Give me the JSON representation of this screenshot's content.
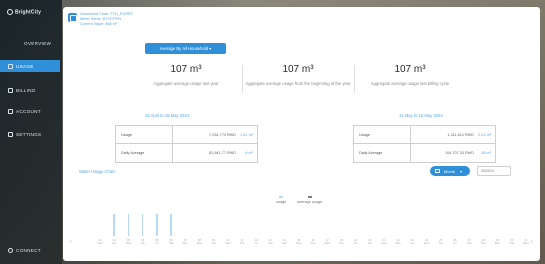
{
  "sidebar": {
    "logo": "BrightCity",
    "items": [
      {
        "id": "overview",
        "label": "OVERVIEW"
      },
      {
        "id": "usage",
        "label": "USAGE"
      },
      {
        "id": "billing",
        "label": "BILLING"
      },
      {
        "id": "account",
        "label": "ACCOUNT"
      },
      {
        "id": "settings",
        "label": "SETTINGS"
      }
    ],
    "connect": "CONNECT"
  },
  "household": {
    "line1": "Household Code: FTH_PORRT",
    "line2": "Meter Serial: BTCFFPIN",
    "line3": "Current Value: 888 m³"
  },
  "avg_button": "Average By All Household ▾",
  "stats": [
    {
      "value": "107 m³",
      "label": "Aggregate average usage last year"
    },
    {
      "value": "107 m³",
      "label": "Aggregate average usage from the beginning of the year"
    },
    {
      "value": "107 m³",
      "label": "Aggregate average usage last billing cycle"
    }
  ],
  "ranges": {
    "left": "15 April to 15 May 2024",
    "right": "15 May to 15 May 2024"
  },
  "table_left": {
    "rows": [
      {
        "key": "Usage",
        "value": "7,034,770 RWD",
        "unit": "1.61 m³"
      },
      {
        "key": "Daily Average",
        "value": "62,641.77 RWD",
        "unit": "4 m³"
      }
    ]
  },
  "table_right": {
    "rows": [
      {
        "key": "Usage",
        "value": "1,311,612 RWD",
        "unit": "2.01 m³"
      },
      {
        "key": "Daily Average",
        "value": "104,707.33 RWD",
        "unit": "28 m³"
      }
    ]
  },
  "chart_section": {
    "title": "Water Usage Chart",
    "period_button": "Month",
    "date_value": "05/2024"
  },
  "chart_data": {
    "type": "bar",
    "series": [
      {
        "name": "usage",
        "color": "#b6d9f6"
      },
      {
        "name": "average usage",
        "color": "#7a7a7a"
      }
    ],
    "x_labels": [
      "01",
      "02",
      "03",
      "04",
      "05",
      "06",
      "07",
      "08",
      "09",
      "10",
      "11",
      "12",
      "13",
      "14",
      "15",
      "16",
      "17",
      "18",
      "19",
      "20",
      "21",
      "22",
      "23",
      "24",
      "25",
      "26",
      "27",
      "28",
      "29",
      "30",
      "31"
    ],
    "x_labels_sub": [
      "Mon",
      "Tue",
      "Wed",
      "Thu",
      "Fri",
      "Sat",
      "Sun",
      "Mon",
      "Tue",
      "Wed",
      "Thu",
      "Fri",
      "Sat",
      "Sun",
      "Mon",
      "Tue",
      "Wed",
      "Thu",
      "Fri",
      "Sat",
      "Sun",
      "Mon",
      "Tue",
      "Wed",
      "Thu",
      "Fri",
      "Sat",
      "Sun",
      "Mon",
      "Tue",
      "Wed"
    ],
    "usage_values": [
      0,
      6,
      6,
      6,
      6,
      6,
      0,
      0,
      0,
      0,
      0,
      0,
      0,
      0,
      0,
      0,
      0,
      0,
      0,
      0,
      0,
      0,
      0,
      0,
      0,
      0,
      0,
      0,
      0,
      0,
      0
    ],
    "ylim": [
      0,
      8
    ]
  }
}
